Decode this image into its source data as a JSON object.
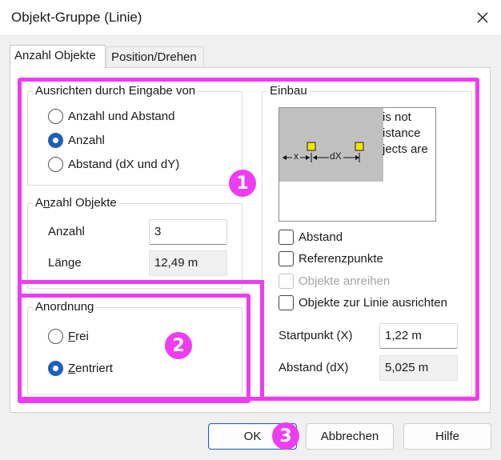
{
  "window": {
    "title": "Objekt-Gruppe (Linie)"
  },
  "tabs": [
    {
      "label": "Anzahl Objekte",
      "active": true
    },
    {
      "label": "Position/Drehen",
      "active": false
    }
  ],
  "ausrichten": {
    "legend": "Ausrichten durch Eingabe von",
    "options": [
      {
        "label": "Anzahl und Abstand",
        "checked": false
      },
      {
        "label": "Anzahl",
        "checked": true
      },
      {
        "label": "Abstand (dX und dY)",
        "checked": false
      }
    ]
  },
  "anzahl_objekte": {
    "legend_pre": "A",
    "legend_accel": "n",
    "legend_post": "zahl Objekte",
    "anzahl_label": "Anzahl",
    "anzahl_value": "3",
    "laenge_label": "Länge",
    "laenge_value": "12,49 m"
  },
  "anordnung": {
    "legend": "Anordnung",
    "options": [
      {
        "accel": "F",
        "rest": "rei",
        "checked": false
      },
      {
        "accel": "Z",
        "rest": "entriert",
        "checked": true
      }
    ]
  },
  "einbau": {
    "legend": "Einbau",
    "preview_lines": [
      "is not",
      "istance",
      "jects are"
    ],
    "preview_x_label": "x",
    "preview_dx_label": "dX",
    "checkboxes": [
      {
        "label": "Abstand",
        "checked": false,
        "disabled": false
      },
      {
        "label": "Referenzpunkte",
        "checked": false,
        "disabled": false
      },
      {
        "label": "Objekte anreihen",
        "checked": false,
        "disabled": true
      },
      {
        "label": "Objekte zur Linie ausrichten",
        "checked": false,
        "disabled": false
      }
    ],
    "startpunkt_label": "Startpunkt (X)",
    "startpunkt_value": "1,22 m",
    "abstand_label": "Abstand (dX)",
    "abstand_value": "5,025 m"
  },
  "buttons": {
    "ok": "OK",
    "abbrechen": "Abbrechen",
    "hilfe": "Hilfe"
  },
  "annotations": {
    "badge1": "1",
    "badge2": "2",
    "badge3": "3",
    "color": "#ee3df0"
  },
  "colors": {
    "accent": "#1f5fb8",
    "highlight": "#ee3df0",
    "panel": "#f0f0f0"
  }
}
